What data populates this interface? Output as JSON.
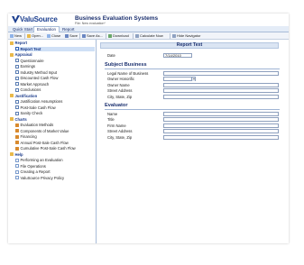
{
  "brand": {
    "name": "ValuSource",
    "app_title": "Business Evaluation Systems",
    "file_label": "File: New evaluation*"
  },
  "tabs": [
    {
      "label": "Quick Start"
    },
    {
      "label": "Evaluation"
    },
    {
      "label": "Report"
    }
  ],
  "toolbar": [
    {
      "label": "New",
      "icon": "new-icon",
      "color": "#8fb3e8"
    },
    {
      "label": "Open...",
      "icon": "open-icon",
      "color": "#e8b94a"
    },
    {
      "label": "Close",
      "icon": "close-icon",
      "color": "#8fb3e8"
    },
    {
      "label": "Save",
      "icon": "save-icon",
      "color": "#6a86c2"
    },
    {
      "label": "Save As...",
      "icon": "save-as-icon",
      "color": "#6a86c2"
    },
    {
      "label": "Download",
      "icon": "download-icon",
      "color": "#6aa86a"
    },
    {
      "label": "Calculate Now",
      "icon": "calculate-icon",
      "color": "#8fa2c2"
    },
    {
      "label": "Hide Navigator",
      "icon": "hide-navigator-icon",
      "color": "#8fa2c2"
    }
  ],
  "sidebar": {
    "items": [
      {
        "label": "Report",
        "kind": "section",
        "icon": "folder-icon"
      },
      {
        "label": "Report Text",
        "kind": "active",
        "icon": "document-icon"
      },
      {
        "label": "Appraisal",
        "kind": "section",
        "icon": "folder-icon"
      },
      {
        "label": "Questionnaire",
        "kind": "item",
        "icon": "document-icon"
      },
      {
        "label": "Earnings",
        "kind": "item",
        "icon": "document-icon"
      },
      {
        "label": "Industry Method Input",
        "kind": "item",
        "icon": "document-icon"
      },
      {
        "label": "Discounted Cash Flow",
        "kind": "item",
        "icon": "document-icon"
      },
      {
        "label": "Market Approach",
        "kind": "item",
        "icon": "document-icon"
      },
      {
        "label": "Conclusions",
        "kind": "item",
        "icon": "document-icon"
      },
      {
        "label": "Justification",
        "kind": "section",
        "icon": "folder-icon"
      },
      {
        "label": "Justification Assumptions",
        "kind": "item",
        "icon": "document-icon"
      },
      {
        "label": "Post-Sale Cash Flow",
        "kind": "item",
        "icon": "document-icon"
      },
      {
        "label": "Sanity Check",
        "kind": "item",
        "icon": "document-icon"
      },
      {
        "label": "Charts",
        "kind": "section",
        "icon": "folder-icon"
      },
      {
        "label": "Evaluation Methods",
        "kind": "item",
        "icon": "chart-icon"
      },
      {
        "label": "Components of Market Value",
        "kind": "item",
        "icon": "chart-icon"
      },
      {
        "label": "Financing",
        "kind": "item",
        "icon": "chart-icon"
      },
      {
        "label": "Annual Post-Sale Cash Flow",
        "kind": "item",
        "icon": "chart-icon"
      },
      {
        "label": "Cumulative Post-Sale Cash Flow",
        "kind": "item",
        "icon": "chart-icon"
      },
      {
        "label": "Help",
        "kind": "section",
        "icon": "folder-icon"
      },
      {
        "label": "Performing an Evaluation",
        "kind": "item",
        "icon": "help-page-icon"
      },
      {
        "label": "File Operations",
        "kind": "item",
        "icon": "help-page-icon"
      },
      {
        "label": "Creating a Report",
        "kind": "item",
        "icon": "help-page-icon"
      },
      {
        "label": "ValuSource Privacy Policy",
        "kind": "item",
        "icon": "help-page-icon"
      }
    ]
  },
  "main": {
    "title": "Report Text",
    "date_label": "Date",
    "date_value": "7/14/2010",
    "subject": {
      "heading": "Subject Business",
      "fields": [
        {
          "label": "Legal Name of Business",
          "value": ""
        },
        {
          "label": "Owner Honorific",
          "value": ""
        },
        {
          "label": "Owner Name",
          "value": ""
        },
        {
          "label": "Street Address",
          "value": ""
        },
        {
          "label": "City, State, Zip",
          "value": ""
        }
      ]
    },
    "evaluator": {
      "heading": "Evaluator",
      "fields": [
        {
          "label": "Name",
          "value": ""
        },
        {
          "label": "Title",
          "value": ""
        },
        {
          "label": "Firm Name",
          "value": ""
        },
        {
          "label": "Street Address",
          "value": ""
        },
        {
          "label": "City, State, Zip",
          "value": ""
        }
      ]
    }
  },
  "colors": {
    "brand": "#1c3f8f",
    "section": "#1a3a8a",
    "panel_header": "#dbe5f3",
    "tab_bar": "#e4ecf7",
    "active_item": "#cfe0f6"
  }
}
